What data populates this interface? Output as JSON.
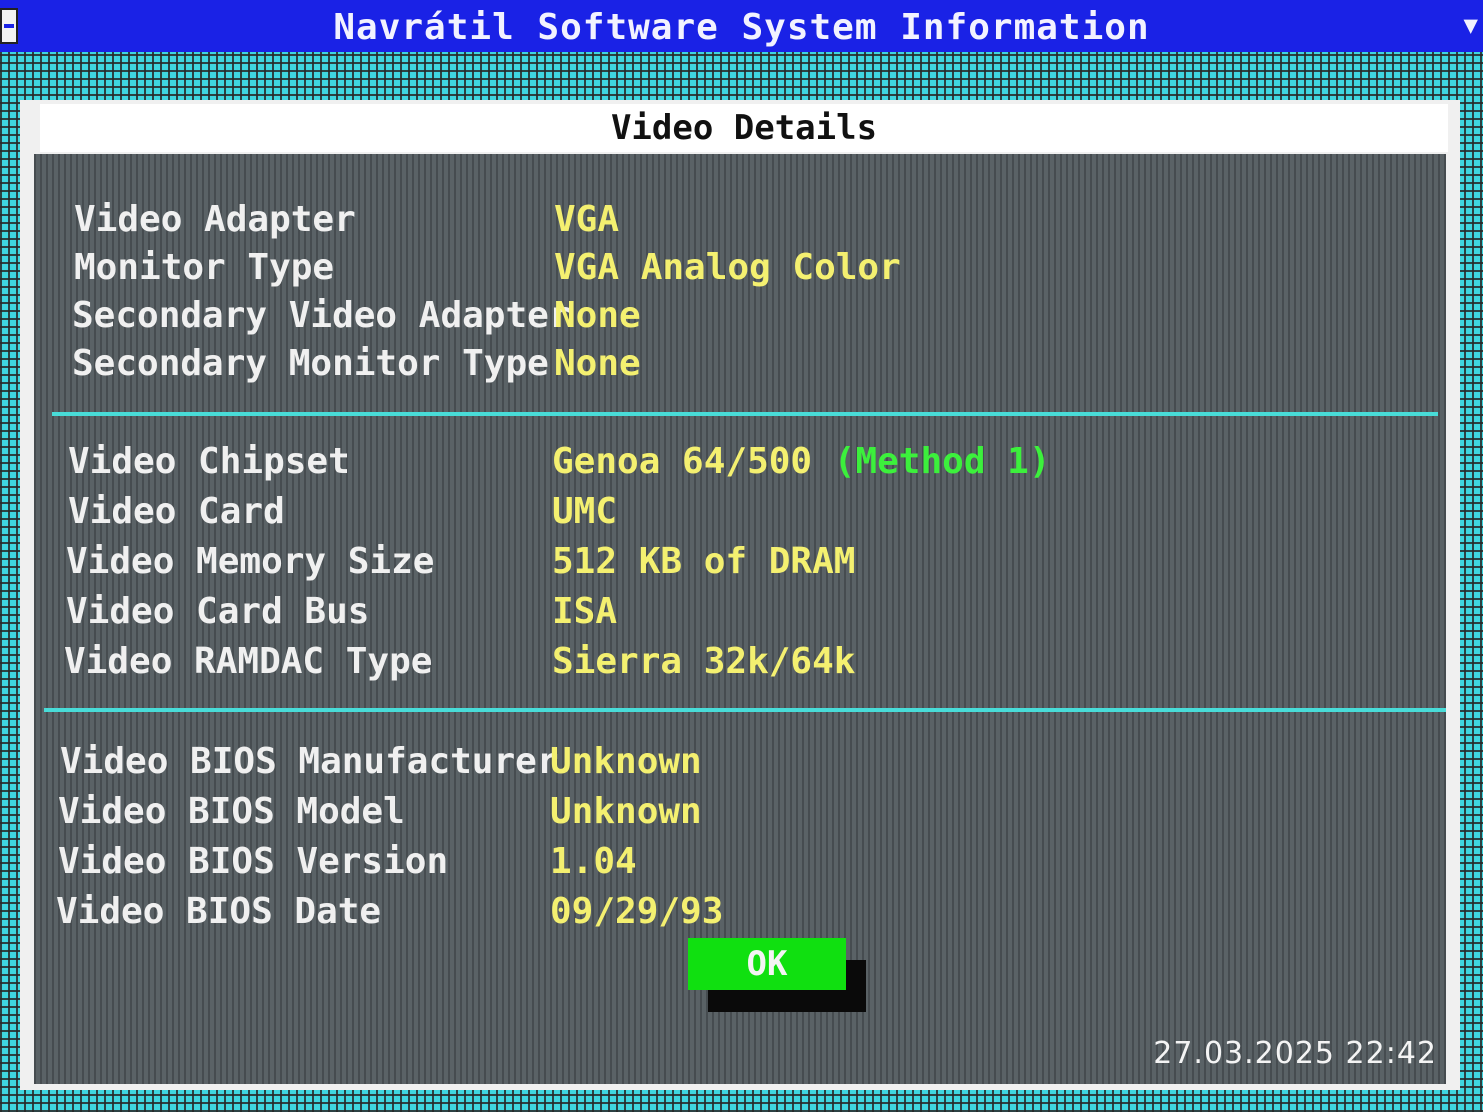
{
  "app": {
    "title": "Navrátil Software System Information"
  },
  "dialog": {
    "title": "Video Details",
    "sections": [
      {
        "rows": [
          {
            "label": "Video Adapter",
            "value": "VGA"
          },
          {
            "label": "Monitor Type",
            "value": "VGA Analog Color"
          },
          {
            "label": "Secondary Video Adapter",
            "value": "None"
          },
          {
            "label": "Secondary Monitor Type",
            "value": "None"
          }
        ]
      },
      {
        "rows": [
          {
            "label": "Video Chipset",
            "value": "Genoa 64/500",
            "note": "(Method 1)"
          },
          {
            "label": "Video Card",
            "value": "UMC"
          },
          {
            "label": "Video Memory Size",
            "value": "512 KB of DRAM"
          },
          {
            "label": "Video Card Bus",
            "value": "ISA"
          },
          {
            "label": "Video RAMDAC Type",
            "value": "Sierra 32k/64k"
          }
        ]
      },
      {
        "rows": [
          {
            "label": "Video BIOS Manufacturer",
            "value": "Unknown"
          },
          {
            "label": "Video BIOS Model",
            "value": "Unknown"
          },
          {
            "label": "Video BIOS Version",
            "value": "1.04"
          },
          {
            "label": "Video BIOS Date",
            "value": "09/29/93"
          }
        ]
      }
    ],
    "ok_label": "OK"
  },
  "photo_timestamp": "27.03.2025 22:42",
  "colors": {
    "app_titlebar": "#1a22e6",
    "label_text": "#f0f0f0",
    "value_text": "#f4f070",
    "note_text": "#3cf03c",
    "separator": "#48dcd8",
    "ok_button": "#10e010",
    "desktop": "#3fd6e0",
    "dialog_client": "#5a6266"
  }
}
